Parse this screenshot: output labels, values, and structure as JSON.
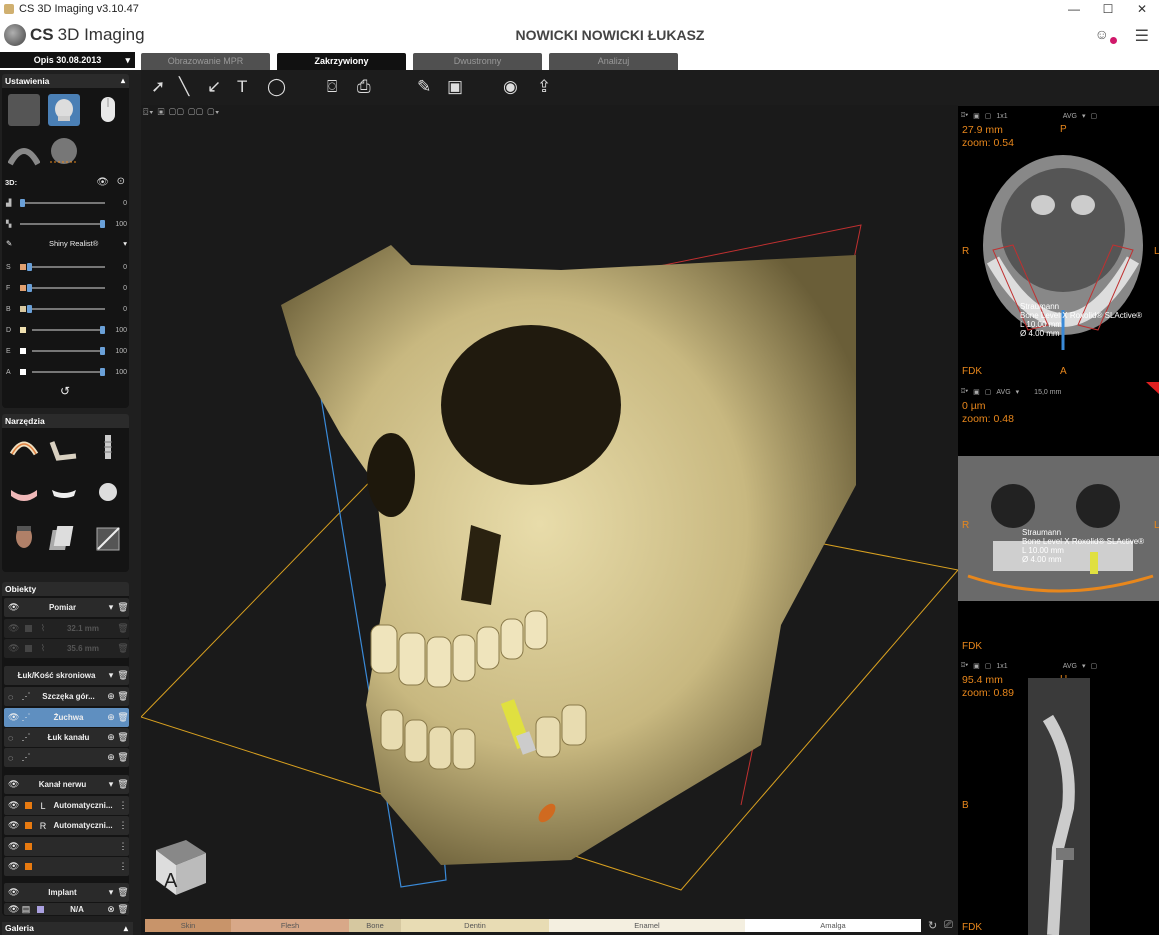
{
  "window": {
    "title": "CS 3D Imaging v3.10.47",
    "minimize": "—",
    "maximize": "☐",
    "close": "✕"
  },
  "header": {
    "logo_cs": "CS",
    "logo_name": "3D Imaging",
    "patient": "NOWICKI NOWICKI ŁUKASZ",
    "menu_icon": "☰"
  },
  "date_select": "Opis 30.08.2013",
  "tabs": [
    {
      "label": "Obrazowanie MPR",
      "active": false
    },
    {
      "label": "Zakrzywiony",
      "active": true
    },
    {
      "label": "Dwustronny",
      "active": false
    },
    {
      "label": "Analizuj",
      "active": false
    }
  ],
  "settings": {
    "title": "Ustawienia",
    "label_3d": "3D:",
    "slider1_value": "0",
    "slider2_value": "100",
    "preset": "Shiny Realist®",
    "channels": [
      {
        "label": "S",
        "value": "0",
        "color": "#e0a070",
        "level": 0
      },
      {
        "label": "F",
        "value": "0",
        "color": "#e0a070",
        "level": 0
      },
      {
        "label": "B",
        "value": "0",
        "color": "#d8c8a0",
        "level": 0
      },
      {
        "label": "D",
        "value": "100",
        "color": "#f0e0b0",
        "level": 100
      },
      {
        "label": "E",
        "value": "100",
        "color": "#ffffff",
        "level": 100
      },
      {
        "label": "A",
        "value": "100",
        "color": "#ffffff",
        "level": 100
      }
    ]
  },
  "tools": {
    "title": "Narzędzia"
  },
  "objects": {
    "title": "Obiekty",
    "measure_group": "Pomiar",
    "measures": [
      "32.1 mm",
      "35.6 mm"
    ],
    "arch_group": "Łuk/Kość skroniowa",
    "arch_items": [
      "Szczęka gór...",
      "Żuchwa",
      "Łuk kanału",
      ""
    ],
    "nerve_group": "Kanał nerwu",
    "nerve_items": [
      {
        "side": "L",
        "name": "Automatyczni..."
      },
      {
        "side": "R",
        "name": "Automatyczni..."
      },
      {
        "side": "",
        "name": ""
      },
      {
        "side": "",
        "name": ""
      }
    ],
    "implant_group": "Implant",
    "implant_item": "N/A"
  },
  "gallery": "Galeria",
  "right_views": {
    "axial": {
      "measure": "27.9 mm",
      "zoom": "zoom: 0.54",
      "top": "P",
      "left": "R",
      "right": "L",
      "bottom_left": "FDK",
      "bottom": "A",
      "mode": "AVG",
      "layout": "1x1",
      "implant_label": [
        "Straumann",
        "Bone Level X Roxolid® SLActive®",
        "L 10.00 mm",
        "Ø 4.00 mm"
      ]
    },
    "pano": {
      "measure": "0 µm",
      "zoom": "zoom: 0.48",
      "left": "R",
      "right": "L",
      "bottom_left": "FDK",
      "mode": "AVG",
      "slab": "15,0 mm",
      "implant_label": [
        "Straumann",
        "Bone Level X Roxolid® SLActive®",
        "L 10.00 mm",
        "Ø 4.00 mm"
      ]
    },
    "cross": {
      "measure": "95.4 mm",
      "zoom": "zoom: 0.89",
      "top": "H",
      "left": "B",
      "bottom_left": "FDK",
      "mode": "AVG",
      "layout": "1x1"
    }
  },
  "cube_letter": "A",
  "transfer_bar": [
    {
      "label": "Skin",
      "color": "#c8946a"
    },
    {
      "label": "Flesh",
      "color": "#d8a888"
    },
    {
      "label": "Bone",
      "color": "#d6c8a0"
    },
    {
      "label": "Dentin",
      "color": "#e8dcb4"
    },
    {
      "label": "Enamel",
      "color": "#f4efe0"
    },
    {
      "label": "Amalga",
      "color": "#ffffff"
    }
  ]
}
